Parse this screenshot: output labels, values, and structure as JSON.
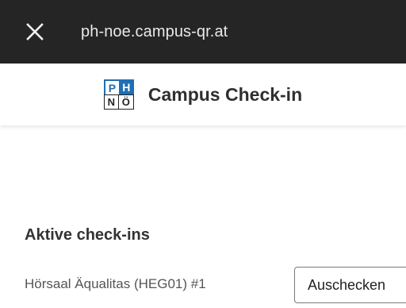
{
  "browser": {
    "url": "ph-noe.campus-qr.at",
    "close_icon": "close-icon"
  },
  "header": {
    "logo": {
      "letters": [
        "P",
        "H",
        "N",
        "Ö"
      ],
      "colors": {
        "blue": "#1f8ad9",
        "dark_blue": "#1f6fb4"
      }
    },
    "title": "Campus Check-in"
  },
  "main": {
    "section_title": "Aktive check-ins",
    "checkins": [
      {
        "room": "Hörsaal Äqualitas (HEG01) #1",
        "action_label": "Auschecken"
      }
    ]
  },
  "colors": {
    "topbar_bg": "#252525",
    "text_dark": "#2f2f2f",
    "text_muted": "#555555"
  }
}
